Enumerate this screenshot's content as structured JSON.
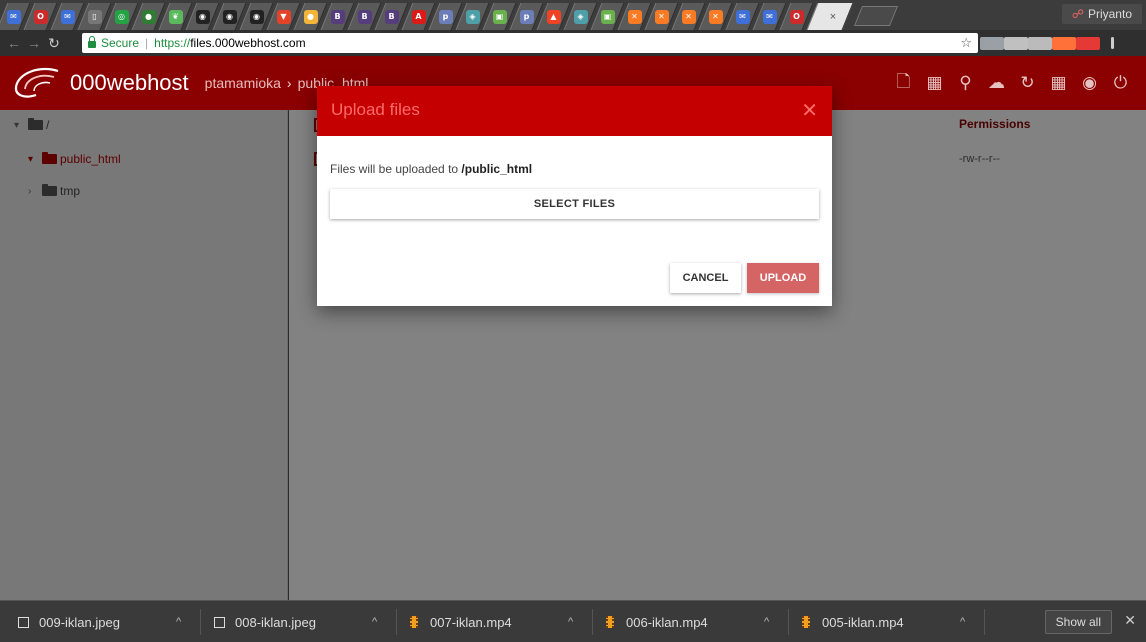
{
  "browser": {
    "profile_name": "Priyanto",
    "security_label": "Secure",
    "url_scheme": "https://",
    "url_host": "files.000webhost.com",
    "tab_close_glyph": "×",
    "tab_favicons": [
      {
        "icon": "mail-icon",
        "color": "#3f6fd8",
        "glyph": "✉"
      },
      {
        "icon": "opera-icon",
        "color": "#cc2b2b",
        "glyph": "O"
      },
      {
        "icon": "mail-icon",
        "color": "#3f6fd8",
        "glyph": "✉"
      },
      {
        "icon": "page-icon",
        "color": "#777777",
        "glyph": "▯"
      },
      {
        "icon": "whatsapp-icon",
        "color": "#25a244",
        "glyph": "◎"
      },
      {
        "icon": "nginx-icon",
        "color": "#2e7d32",
        "glyph": "●"
      },
      {
        "icon": "leaf-icon",
        "color": "#5cb85c",
        "glyph": "❦"
      },
      {
        "icon": "github-icon",
        "color": "#222222",
        "glyph": "◉"
      },
      {
        "icon": "github-icon",
        "color": "#222222",
        "glyph": "◉"
      },
      {
        "icon": "github-icon",
        "color": "#222222",
        "glyph": "◉"
      },
      {
        "icon": "gitlab-icon",
        "color": "#e24329",
        "glyph": "▼"
      },
      {
        "icon": "mascot-icon",
        "color": "#f3b43a",
        "glyph": "●"
      },
      {
        "icon": "bootstrap-icon",
        "color": "#563d7c",
        "glyph": "B"
      },
      {
        "icon": "bootstrap-icon",
        "color": "#563d7c",
        "glyph": "B"
      },
      {
        "icon": "bootstrap-icon",
        "color": "#563d7c",
        "glyph": "B"
      },
      {
        "icon": "angular-icon",
        "color": "#dd1b16",
        "glyph": "A"
      },
      {
        "icon": "php-icon",
        "color": "#6c7eb7",
        "glyph": "p"
      },
      {
        "icon": "settings-icon",
        "color": "#4f9fa8",
        "glyph": "◈"
      },
      {
        "icon": "image-icon",
        "color": "#6ab04c",
        "glyph": "▣"
      },
      {
        "icon": "php-icon",
        "color": "#6c7eb7",
        "glyph": "p"
      },
      {
        "icon": "codeigniter-icon",
        "color": "#ee4323",
        "glyph": "▲"
      },
      {
        "icon": "settings-icon",
        "color": "#4f9fa8",
        "glyph": "◈"
      },
      {
        "icon": "image-icon",
        "color": "#6ab04c",
        "glyph": "▣"
      },
      {
        "icon": "xampp-icon",
        "color": "#fb7a24",
        "glyph": "✕"
      },
      {
        "icon": "xampp-icon",
        "color": "#fb7a24",
        "glyph": "✕"
      },
      {
        "icon": "xampp-icon",
        "color": "#fb7a24",
        "glyph": "✕"
      },
      {
        "icon": "xampp-icon",
        "color": "#fb7a24",
        "glyph": "✕"
      },
      {
        "icon": "mail-icon",
        "color": "#3f6fd8",
        "glyph": "✉"
      },
      {
        "icon": "mail-icon",
        "color": "#3f6fd8",
        "glyph": "✉"
      },
      {
        "icon": "opera-icon",
        "color": "#cc2b2b",
        "glyph": "O"
      }
    ],
    "extensions": [
      {
        "name": "star-icon",
        "color": "#555555"
      },
      {
        "name": "extension-infinity-icon",
        "color": "#9aa0a6"
      },
      {
        "name": "extension-square-icon",
        "color": "#c0c0c0"
      },
      {
        "name": "opera-extension-icon",
        "color": "#bbbbbb"
      },
      {
        "name": "firefox-extension-icon",
        "color": "#ff7139"
      },
      {
        "name": "cors-extension-icon",
        "color": "#e53935"
      },
      {
        "name": "chrome-menu-icon",
        "color": "#cccccc"
      }
    ]
  },
  "app": {
    "brand": "000webhost",
    "breadcrumb": [
      "ptamamioka",
      "public_html"
    ],
    "header_icons": [
      "new-file-icon",
      "new-folder-icon",
      "search-icon",
      "upload-icon",
      "refresh-icon",
      "grid-icon",
      "globe-icon",
      "power-icon"
    ],
    "colors": {
      "header": "#8b0000",
      "modal_header": "#c40000",
      "upload_button": "#d56464"
    }
  },
  "sidebar": {
    "root": "/",
    "items": [
      {
        "label": "public_html",
        "active": true,
        "expanded": true
      },
      {
        "label": "tmp",
        "active": false,
        "expanded": false
      }
    ]
  },
  "content": {
    "columns": [
      "Permissions"
    ],
    "rows": [
      {
        "permissions": "-rw-r--r--"
      }
    ]
  },
  "modal": {
    "title": "Upload files",
    "text_prefix": "Files will be uploaded to ",
    "target_path": "/public_html",
    "select_label": "SELECT FILES",
    "cancel_label": "CANCEL",
    "upload_label": "UPLOAD"
  },
  "downloads": {
    "items": [
      {
        "name": "009-iklan.jpeg",
        "type": "image"
      },
      {
        "name": "008-iklan.jpeg",
        "type": "image"
      },
      {
        "name": "007-iklan.mp4",
        "type": "video"
      },
      {
        "name": "006-iklan.mp4",
        "type": "video"
      },
      {
        "name": "005-iklan.mp4",
        "type": "video"
      }
    ],
    "show_all_label": "Show all"
  }
}
